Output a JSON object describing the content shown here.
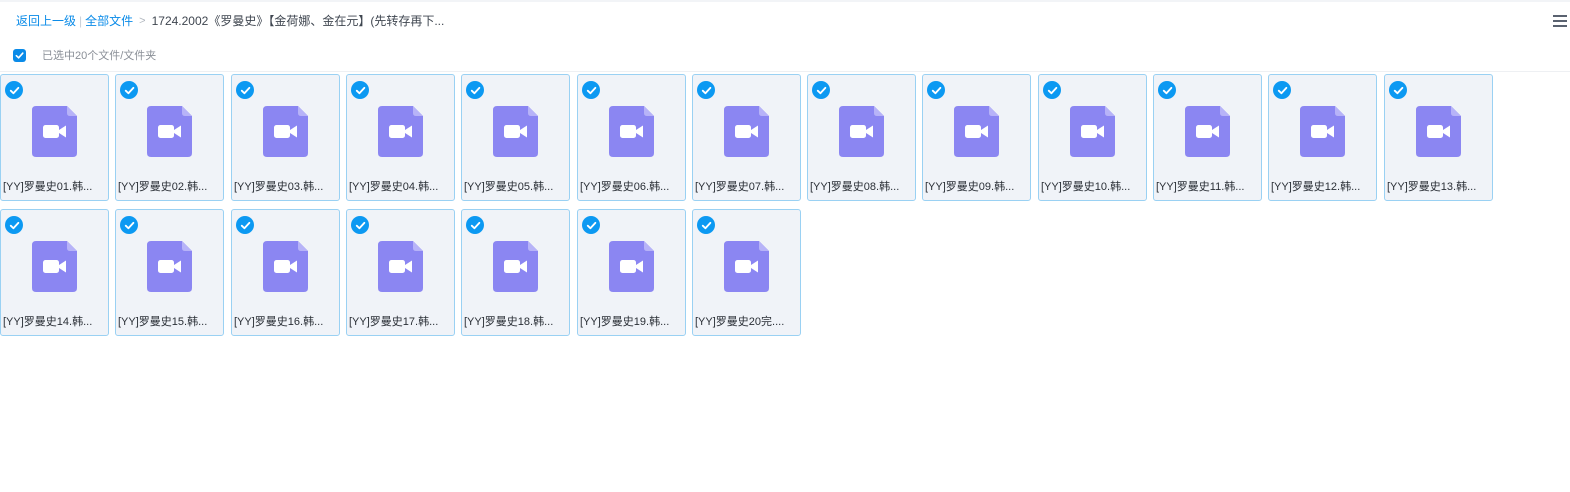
{
  "breadcrumb": {
    "back_label": "返回上一级",
    "separator": "|",
    "all_files_label": "全部文件",
    "arrow": ">",
    "current_folder": "1724.2002《罗曼史》【金荷娜、金在元】(先转存再下..."
  },
  "toolbar": {
    "menu_icon": "hamburger-menu-icon",
    "selected_text": "已选中20个文件/文件夹",
    "select_all_checked": true
  },
  "colors": {
    "accent": "#0a8be8",
    "check_blue": "#0c99f2",
    "tile_bg": "#f0f3f8",
    "tile_border": "#9ad1f3",
    "video_icon": "#8b86f2"
  },
  "files": [
    {
      "name": "[YY]罗曼史01.韩...",
      "icon": "video-file-icon",
      "selected": true
    },
    {
      "name": "[YY]罗曼史02.韩...",
      "icon": "video-file-icon",
      "selected": true
    },
    {
      "name": "[YY]罗曼史03.韩...",
      "icon": "video-file-icon",
      "selected": true
    },
    {
      "name": "[YY]罗曼史04.韩...",
      "icon": "video-file-icon",
      "selected": true
    },
    {
      "name": "[YY]罗曼史05.韩...",
      "icon": "video-file-icon",
      "selected": true
    },
    {
      "name": "[YY]罗曼史06.韩...",
      "icon": "video-file-icon",
      "selected": true
    },
    {
      "name": "[YY]罗曼史07.韩...",
      "icon": "video-file-icon",
      "selected": true
    },
    {
      "name": "[YY]罗曼史08.韩...",
      "icon": "video-file-icon",
      "selected": true
    },
    {
      "name": "[YY]罗曼史09.韩...",
      "icon": "video-file-icon",
      "selected": true
    },
    {
      "name": "[YY]罗曼史10.韩...",
      "icon": "video-file-icon",
      "selected": true
    },
    {
      "name": "[YY]罗曼史11.韩...",
      "icon": "video-file-icon",
      "selected": true
    },
    {
      "name": "[YY]罗曼史12.韩...",
      "icon": "video-file-icon",
      "selected": true
    },
    {
      "name": "[YY]罗曼史13.韩...",
      "icon": "video-file-icon",
      "selected": true
    },
    {
      "name": "[YY]罗曼史14.韩...",
      "icon": "video-file-icon",
      "selected": true
    },
    {
      "name": "[YY]罗曼史15.韩...",
      "icon": "video-file-icon",
      "selected": true
    },
    {
      "name": "[YY]罗曼史16.韩...",
      "icon": "video-file-icon",
      "selected": true
    },
    {
      "name": "[YY]罗曼史17.韩...",
      "icon": "video-file-icon",
      "selected": true
    },
    {
      "name": "[YY]罗曼史18.韩...",
      "icon": "video-file-icon",
      "selected": true
    },
    {
      "name": "[YY]罗曼史19.韩...",
      "icon": "video-file-icon",
      "selected": true
    },
    {
      "name": "[YY]罗曼史20完....",
      "icon": "video-file-icon",
      "selected": true
    }
  ]
}
